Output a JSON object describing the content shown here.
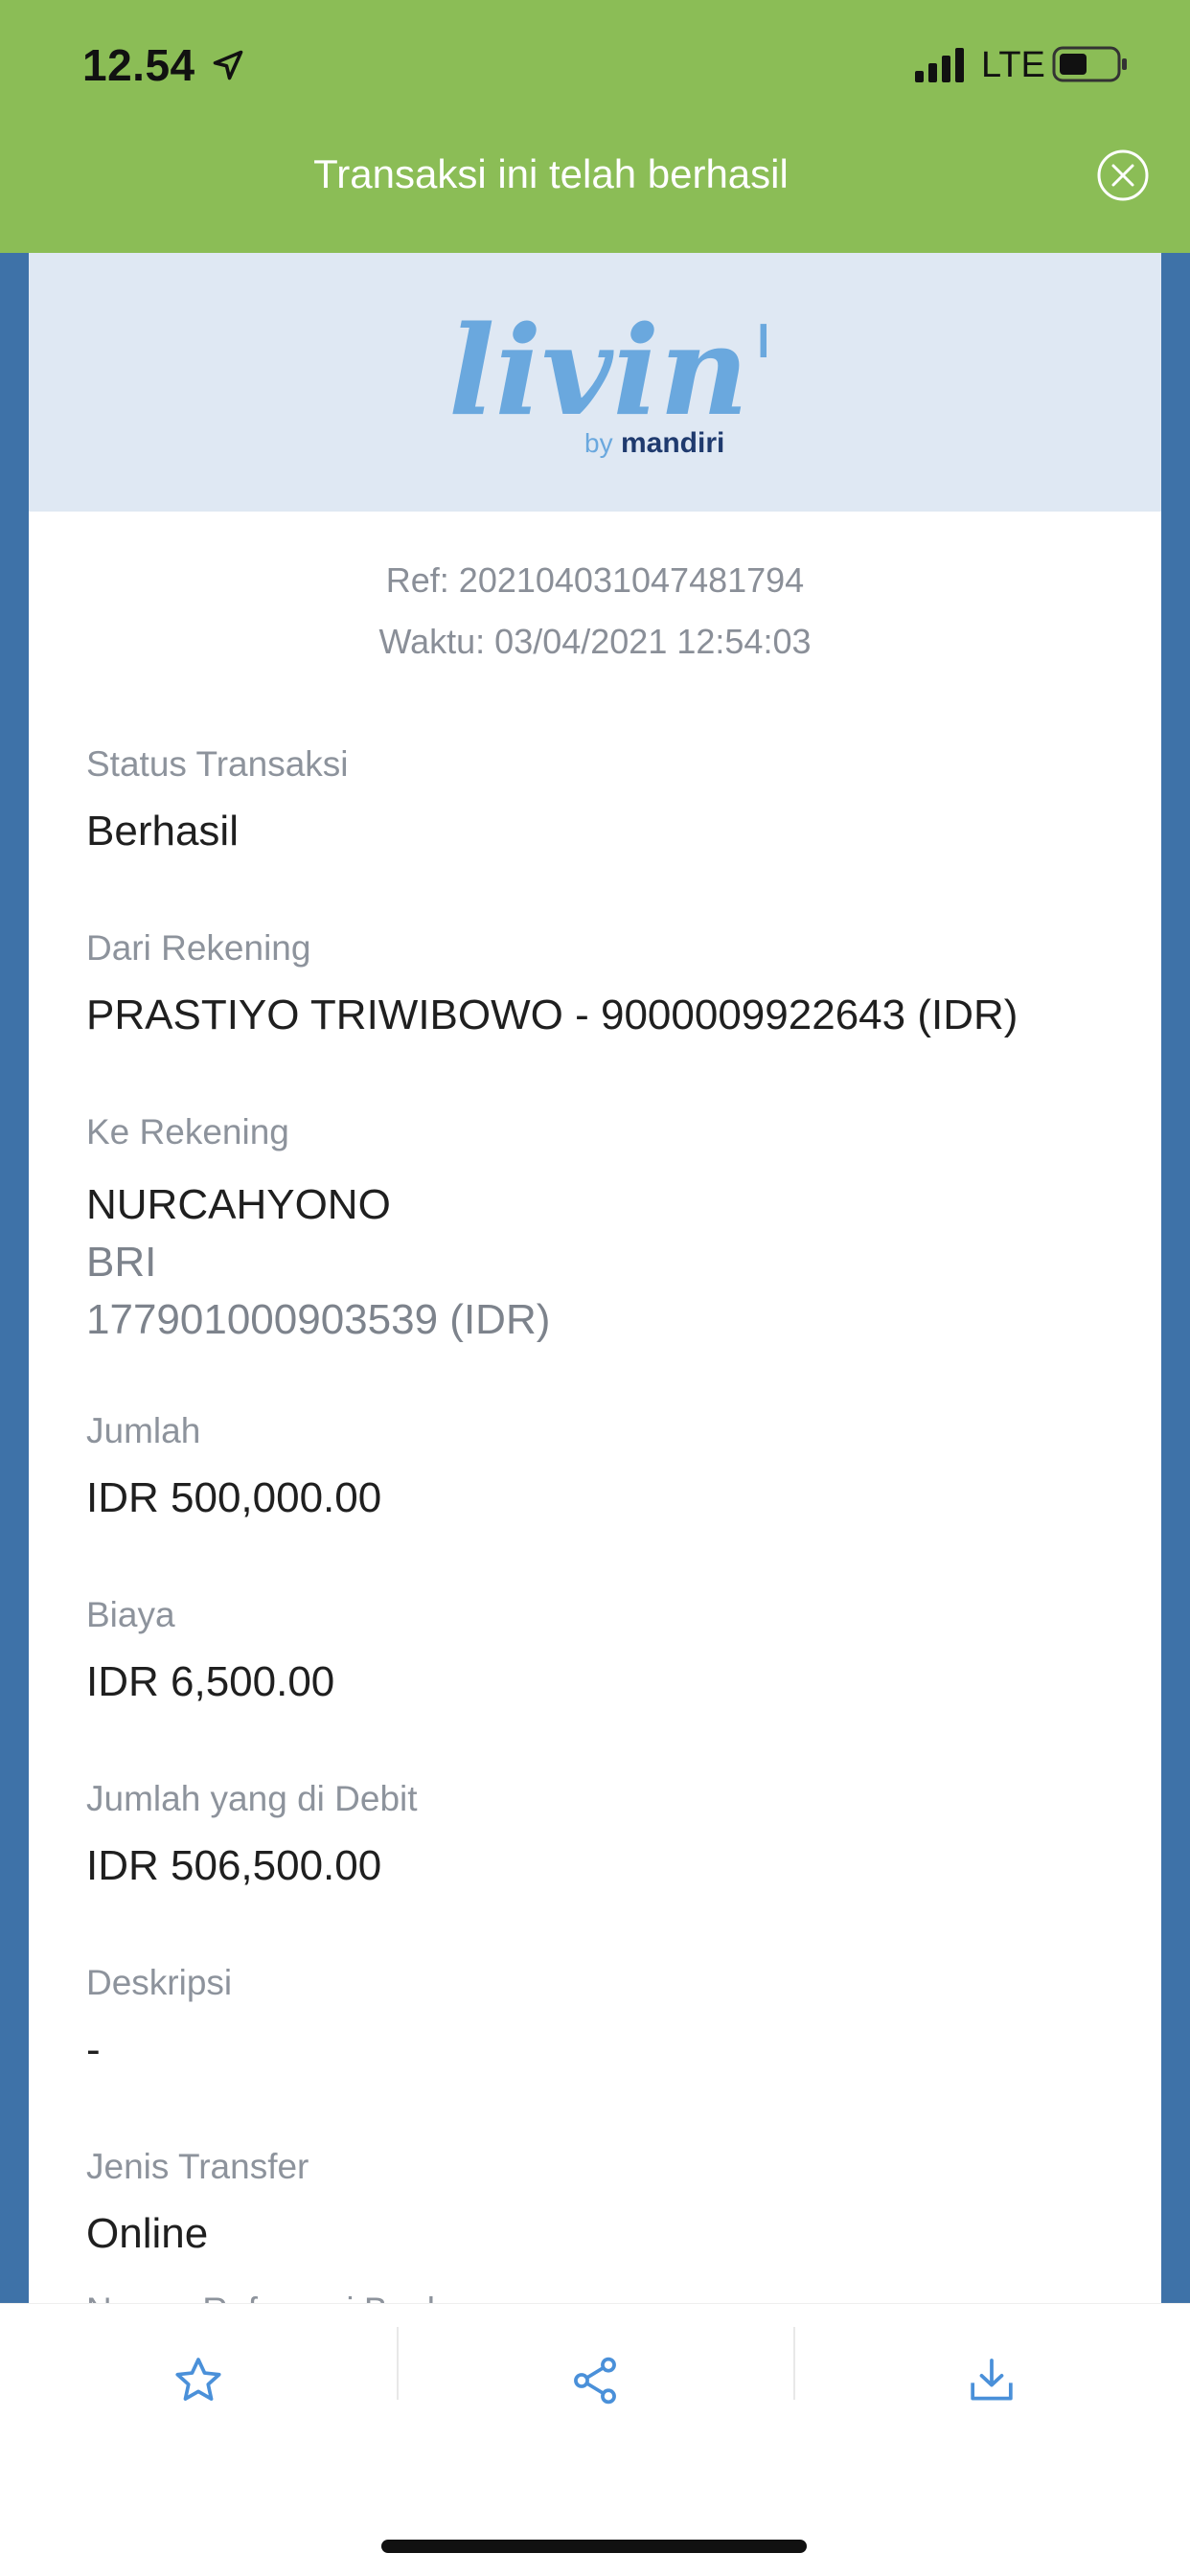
{
  "status_bar": {
    "time": "12.54",
    "network": "LTE"
  },
  "header": {
    "title": "Transaksi ini telah berhasil"
  },
  "receipt": {
    "logo": {
      "wordmark": "livin'",
      "byline_by": "by",
      "byline_brand": "mandiri"
    },
    "ref": "Ref: 2021040310474817​94",
    "waktu": "Waktu: 03/04/2021 12:54:03",
    "fields": {
      "status": {
        "label": "Status Transaksi",
        "value": "Berhasil"
      },
      "dari": {
        "label": "Dari Rekening",
        "value": "PRASTIYO TRIWIBOWO - 9000009922643 (IDR)"
      },
      "ke": {
        "label": "Ke Rekening",
        "name": "NURCAHYONO",
        "bank": "BRI",
        "account": "177901000903539 (IDR)"
      },
      "jumlah": {
        "label": "Jumlah",
        "value": "IDR 500,000.00"
      },
      "biaya": {
        "label": "Biaya",
        "value": "IDR 6,500.00"
      },
      "debit": {
        "label": "Jumlah yang di Debit",
        "value": "IDR 506,500.00"
      },
      "deskripsi": {
        "label": "Deskripsi",
        "value": "-"
      },
      "jenis": {
        "label": "Jenis Transfer",
        "value": "Online"
      },
      "nomor_ref": {
        "label": "Nomor Referensi Bank"
      }
    }
  },
  "icons": {
    "close": "close-circle-icon",
    "favorite": "star-icon",
    "share": "share-icon",
    "download": "download-icon"
  },
  "colors": {
    "header_green": "#8bbd56",
    "side_blue": "#3e72a8",
    "logo_banner": "#dfe8f3",
    "logo_blue": "#6aa8de",
    "logo_yellow": "#f2b534",
    "mandiri_navy": "#1f3a6e",
    "icon_blue": "#4a90d9"
  }
}
